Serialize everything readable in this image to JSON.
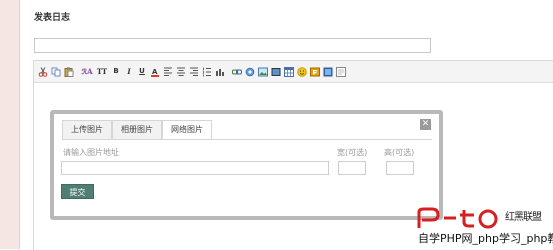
{
  "page": {
    "title": "发表日志"
  },
  "title_field": {
    "value": ""
  },
  "toolbar": {
    "buttons": [
      {
        "name": "cut-icon"
      },
      {
        "name": "copy-icon"
      },
      {
        "name": "paste-icon"
      },
      {
        "name": "font-family-icon",
        "label": "ℛA"
      },
      {
        "name": "font-size-icon",
        "label": "TT"
      },
      {
        "name": "bold-icon",
        "label": "B"
      },
      {
        "name": "italic-icon",
        "label": "I"
      },
      {
        "name": "underline-icon",
        "label": "U"
      },
      {
        "name": "font-color-icon",
        "label": "A"
      }
    ]
  },
  "dialog": {
    "tabs": [
      "上传图片",
      "相册图片",
      "网络图片"
    ],
    "active_tab": "网络图片",
    "close_label": "✕",
    "url_label": "请输入图片地址",
    "width_label": "宽(可选)",
    "height_label": "高(可选)",
    "url_value": "",
    "width_value": "",
    "height_value": "",
    "submit_label": "提交"
  },
  "watermark": {
    "logo_text": "Pto",
    "line1": "红黑联盟",
    "line2": "自学PHP网_php学习_php教"
  },
  "colors": {
    "submit_bg": "#4f7e73",
    "dialog_border": "#b9b9b9",
    "watermark_red": "#d42020",
    "left_strip": "#f6e6e3"
  }
}
